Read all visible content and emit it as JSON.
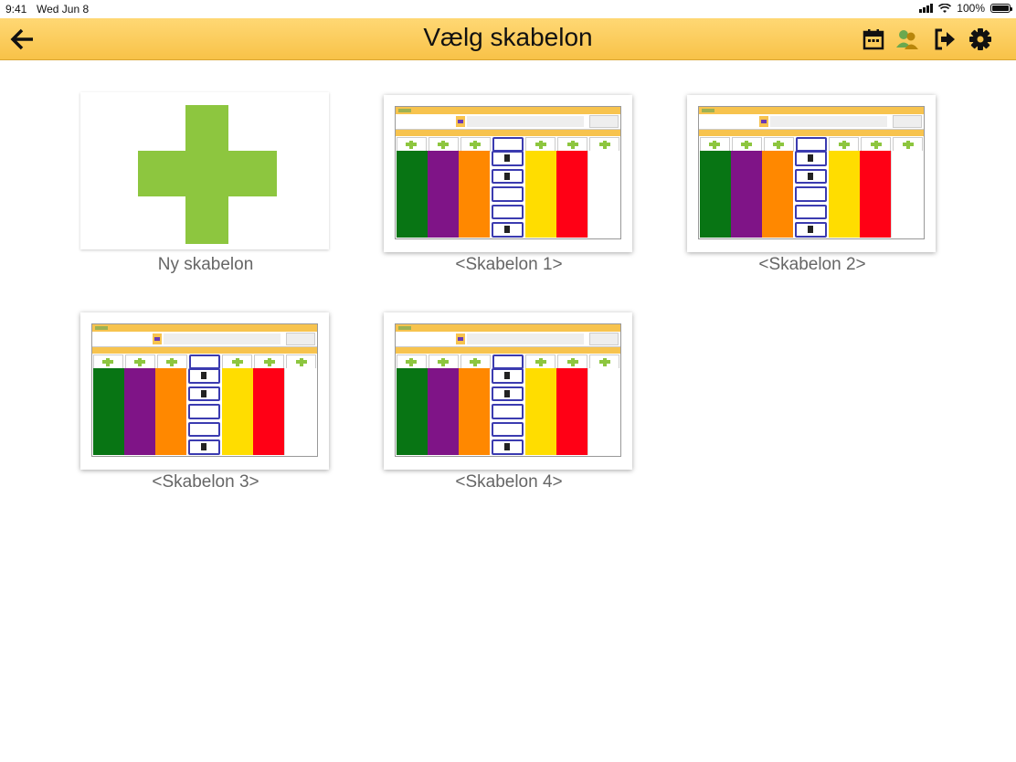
{
  "status_bar": {
    "time": "9:41",
    "date": "Wed Jun 8",
    "battery": "100%"
  },
  "header": {
    "title": "Vælg skabelon",
    "icons": [
      "back-arrow-icon",
      "calendar-icon",
      "users-icon",
      "logout-icon",
      "gear-icon"
    ]
  },
  "colors": {
    "header": "#f8c248",
    "plus": "#8dc63f",
    "columns": [
      "#087514",
      "#7f1487",
      "#ff8800",
      "#ffffff",
      "#ffdd00",
      "#ff0015",
      "#ffffff"
    ],
    "label": "#666666"
  },
  "tiles": [
    {
      "label": "Ny skabelon"
    },
    {
      "label": "<Skabelon 1>"
    },
    {
      "label": "<Skabelon 2>"
    },
    {
      "label": "<Skabelon 3>"
    },
    {
      "label": "<Skabelon 4>"
    }
  ]
}
